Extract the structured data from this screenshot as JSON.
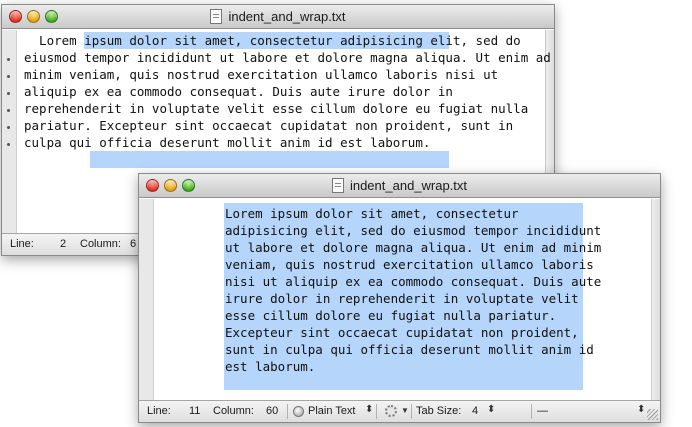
{
  "window1": {
    "title": "indent_and_wrap.txt",
    "lines": [
      "  Lorem ipsum dolor sit amet, consectetur adipisicing elit, sed do",
      "eiusmod tempor incididunt ut labore et dolore magna aliqua. Ut enim ad",
      "minim veniam, quis nostrud exercitation ullamco laboris nisi ut",
      "aliquip ex ea commodo consequat. Duis aute irure dolor in",
      "reprehenderit in voluptate velit esse cillum dolore eu fugiat nulla",
      "pariatur. Excepteur sint occaecat cupidatat non proident, sunt in",
      "culpa qui officia deserunt mollit anim id est laborum."
    ],
    "status": {
      "line_label": "Line:",
      "line_value": "2",
      "column_label": "Column:",
      "column_value": "6"
    }
  },
  "window2": {
    "title": "indent_and_wrap.txt",
    "lines": [
      "Lorem ipsum dolor sit amet, consectetur",
      "adipisicing elit, sed do eiusmod tempor incididunt",
      "ut labore et dolore magna aliqua. Ut enim ad minim",
      "veniam, quis nostrud exercitation ullamco laboris",
      "nisi ut aliquip ex ea commodo consequat. Duis aute",
      "irure dolor in reprehenderit in voluptate velit",
      "esse cillum dolore eu fugiat nulla pariatur.",
      "Excepteur sint occaecat cupidatat non proident,",
      "sunt in culpa qui officia deserunt mollit anim id",
      "est laborum."
    ],
    "status": {
      "line_label": "Line:",
      "line_value": "11",
      "column_label": "Column:",
      "column_value": "60",
      "syntax": "Plain Text",
      "tab_label": "Tab Size:",
      "tab_value": "4",
      "symbol": "—"
    }
  },
  "colors": {
    "selection": "#b5d5fb",
    "status_bg": "#e6e6e6"
  }
}
